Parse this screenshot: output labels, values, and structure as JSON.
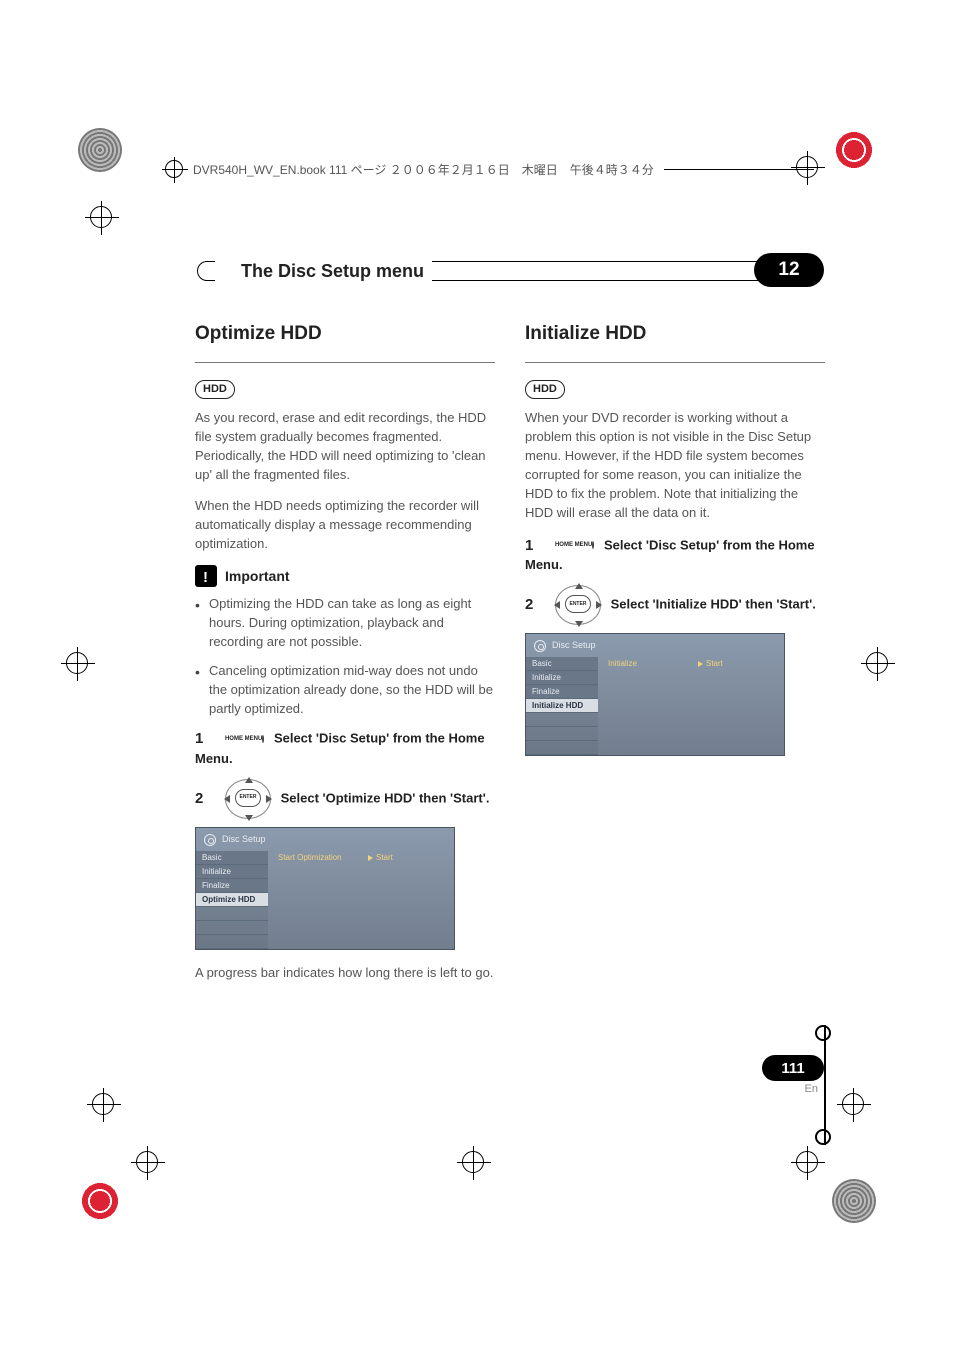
{
  "source_header": "DVR540H_WV_EN.book  111 ページ  ２００６年２月１６日　木曜日　午後４時３４分",
  "chapter": {
    "title": "The Disc Setup menu",
    "number": "12"
  },
  "page": {
    "number": "111",
    "lang": "En"
  },
  "left": {
    "heading": "Optimize HDD",
    "badge": "HDD",
    "para1": "As you record, erase and edit recordings, the HDD file system gradually becomes fragmented. Periodically, the HDD will need optimizing to 'clean up' all the fragmented files.",
    "para2": "When the HDD needs optimizing the recorder will automatically display a message recommending optimization.",
    "important_label": "Important",
    "bullet1": "Optimizing the HDD can take as long as eight hours. During optimization, playback and recording are not possible.",
    "bullet2": "Canceling optimization mid-way does not undo the optimization already done, so the HDD will be partly optimized.",
    "step1_num": "1",
    "step1_btn": "HOME MENU",
    "step1_text": "Select 'Disc Setup' from the Home Menu.",
    "step2_num": "2",
    "step2_btn": "ENTER",
    "step2_text": "Select 'Optimize HDD' then 'Start'.",
    "osd": {
      "title": "Disc Setup",
      "side": [
        "Basic",
        "Initialize",
        "Finalize",
        "Optimize HDD"
      ],
      "highlight_index": 3,
      "mid": "Start Optimization",
      "right": "Start"
    },
    "para3": "A progress bar indicates how long there is left to go."
  },
  "right": {
    "heading": "Initialize HDD",
    "badge": "HDD",
    "para1": "When your DVD recorder is working without a problem this option is not visible in the Disc Setup menu. However, if the HDD file system becomes corrupted for some reason, you can initialize the HDD to fix the problem. Note that initializing the HDD will erase all the data on it.",
    "step1_num": "1",
    "step1_btn": "HOME MENU",
    "step1_text": "Select 'Disc Setup' from the Home Menu.",
    "step2_num": "2",
    "step2_btn": "ENTER",
    "step2_text": "Select 'Initialize HDD' then 'Start'.",
    "osd": {
      "title": "Disc Setup",
      "side": [
        "Basic",
        "Initialize",
        "Finalize",
        "Initialize HDD"
      ],
      "highlight_index": 3,
      "mid": "Initialize",
      "right": "Start"
    }
  }
}
